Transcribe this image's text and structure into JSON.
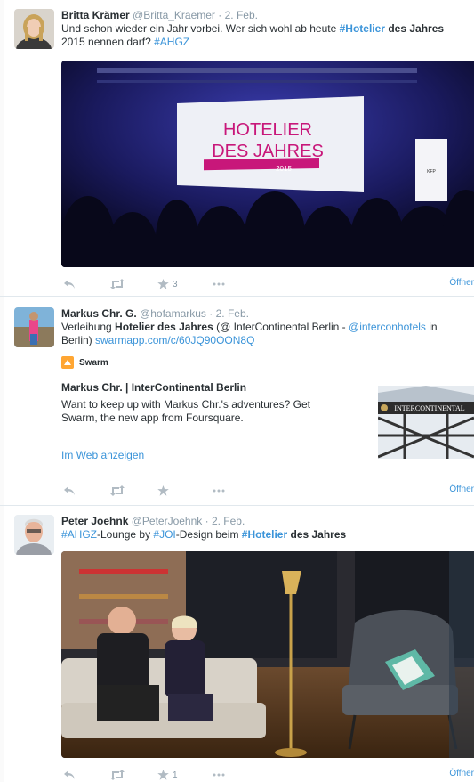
{
  "tweets": [
    {
      "fullname": "Britta Krämer",
      "username": "@Britta_Kraemer",
      "time": "· 2. Feb.",
      "text": [
        {
          "t": "Und schon wieder ein Jahr vorbei. Wer sich wohl ab heute "
        },
        {
          "t": "#Hotelier",
          "cls": "link bold"
        },
        {
          "t": " "
        },
        {
          "t": "des",
          "cls": "bold"
        },
        {
          "t": " "
        },
        {
          "t": "Jahres",
          "cls": "bold"
        },
        {
          "t": " 2015 nennen darf? "
        },
        {
          "t": "#AHGZ",
          "cls": "link"
        }
      ],
      "image": {
        "screen_line1": "HOTELIER",
        "screen_line2": "DES JAHRES",
        "screen_year": "2015",
        "side_screen": "KFP"
      },
      "favorites": "3",
      "open_label": "Öffner"
    },
    {
      "fullname": "Markus Chr. G.",
      "username": "@hofamarkus",
      "time": "· 2. Feb.",
      "text": [
        {
          "t": "Verleihung "
        },
        {
          "t": "Hotelier des Jahres",
          "cls": "bold"
        },
        {
          "t": " (@ InterContinental Berlin - "
        },
        {
          "t": "@interconhotels",
          "cls": "link"
        },
        {
          "t": " in Berlin) "
        },
        {
          "t": "swarmapp.com/c/60JQ90OON8Q",
          "cls": "link"
        }
      ],
      "card": {
        "source": "Swarm",
        "title": "Markus Chr. | InterContinental Berlin",
        "description": "Want to keep up with Markus Chr.'s adventures? Get Swarm, the new app from Foursquare.",
        "thumb_text": "INTERCONTINENTAL",
        "web_link": "Im Web anzeigen"
      },
      "favorites": "",
      "open_label": "Öffner"
    },
    {
      "fullname": "Peter Joehnk",
      "username": "@PeterJoehnk",
      "time": "· 2. Feb.",
      "text": [
        {
          "t": "#AHGZ",
          "cls": "link"
        },
        {
          "t": "-Lounge by "
        },
        {
          "t": "#JOI",
          "cls": "link"
        },
        {
          "t": "-Design beim "
        },
        {
          "t": "#Hotelier",
          "cls": "link bold"
        },
        {
          "t": " "
        },
        {
          "t": "des Jahres",
          "cls": "bold"
        }
      ],
      "favorites": "1",
      "open_label": "Öffner"
    }
  ],
  "colors": {
    "link": "#3b94d9",
    "icon": "#b1bbc3",
    "screen_magenta": "#c8177a",
    "stage_blue": "#1a1a5e"
  }
}
